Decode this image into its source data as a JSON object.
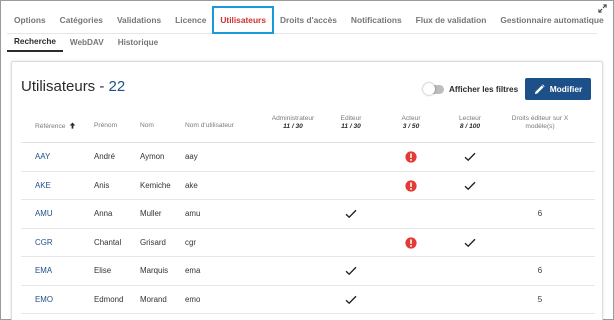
{
  "tabs": [
    {
      "label": "Options",
      "active": false
    },
    {
      "label": "Catégories",
      "active": false
    },
    {
      "label": "Validations",
      "active": false
    },
    {
      "label": "Licence",
      "active": false
    },
    {
      "label": "Utilisateurs",
      "active": true
    },
    {
      "label": "Droits d'accès",
      "active": false
    },
    {
      "label": "Notifications",
      "active": false
    },
    {
      "label": "Flux de validation",
      "active": false
    },
    {
      "label": "Gestionnaire automatique",
      "active": false
    }
  ],
  "subtabs": [
    {
      "label": "Recherche",
      "active": true
    },
    {
      "label": "WebDAV",
      "active": false
    },
    {
      "label": "Historique",
      "active": false
    }
  ],
  "panel": {
    "title": "Utilisateurs - ",
    "count": "22",
    "filter_toggle_label": "Afficher les filtres",
    "filter_toggle_on": false,
    "edit_button_label": "Modifier"
  },
  "table": {
    "headers": {
      "reference": "Référence",
      "prenom": "Prénom",
      "nom": "Nom",
      "username": "Nom d'utilisateur",
      "admin": {
        "label": "Administrateur",
        "sub": "11 / 30"
      },
      "editeur": {
        "label": "Editeur",
        "sub": "11 / 30"
      },
      "acteur": {
        "label": "Acteur",
        "sub": "3 / 50"
      },
      "lecteur": {
        "label": "Lecteur",
        "sub": "8 / 100"
      },
      "droits_line1": "Droits éditeur sur X",
      "droits_line2": "modèle(s)"
    },
    "rows": [
      {
        "ref": "AAY",
        "prenom": "André",
        "nom": "Aymon",
        "username": "aay",
        "admin": false,
        "editeur": false,
        "acteur": "alert",
        "lecteur": true,
        "droits": ""
      },
      {
        "ref": "AKE",
        "prenom": "Anis",
        "nom": "Kemiche",
        "username": "ake",
        "admin": false,
        "editeur": false,
        "acteur": "alert",
        "lecteur": true,
        "droits": ""
      },
      {
        "ref": "AMU",
        "prenom": "Anna",
        "nom": "Muller",
        "username": "amu",
        "admin": false,
        "editeur": true,
        "acteur": "",
        "lecteur": false,
        "droits": "6"
      },
      {
        "ref": "CGR",
        "prenom": "Chantal",
        "nom": "Grisard",
        "username": "cgr",
        "admin": false,
        "editeur": false,
        "acteur": "alert",
        "lecteur": true,
        "droits": ""
      },
      {
        "ref": "EMA",
        "prenom": "Elise",
        "nom": "Marquis",
        "username": "ema",
        "admin": false,
        "editeur": true,
        "acteur": "",
        "lecteur": false,
        "droits": "6"
      },
      {
        "ref": "EMO",
        "prenom": "Edmond",
        "nom": "Morand",
        "username": "emo",
        "admin": false,
        "editeur": true,
        "acteur": "",
        "lecteur": false,
        "droits": "5"
      }
    ]
  },
  "colors": {
    "accent_blue": "#1d4f88",
    "active_tab_red": "#d0312d",
    "highlight_outline": "#1a9bd7",
    "alert_red": "#e53935"
  }
}
